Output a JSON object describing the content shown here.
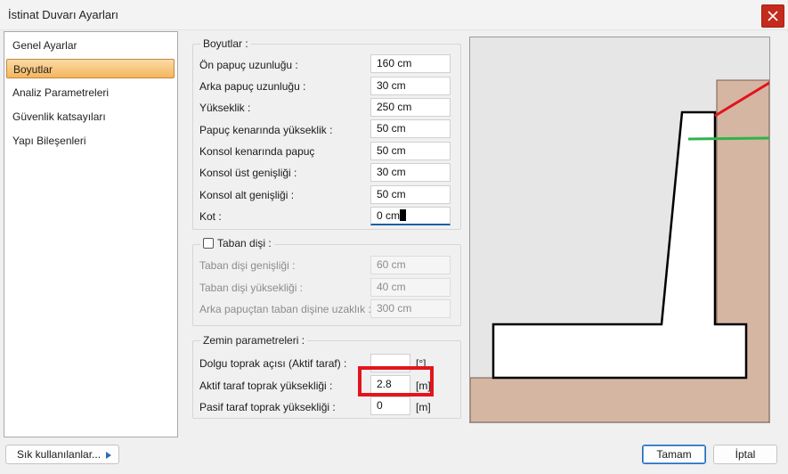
{
  "window": {
    "title": "İstinat Duvarı Ayarları"
  },
  "sidebar": {
    "items": [
      {
        "label": "Genel Ayarlar"
      },
      {
        "label": "Boyutlar"
      },
      {
        "label": "Analiz Parametreleri"
      },
      {
        "label": "Güvenlik katsayıları"
      },
      {
        "label": "Yapı Bileşenleri"
      }
    ],
    "active_index": 1
  },
  "dimensions": {
    "title": "Boyutlar :",
    "rows": [
      {
        "label": "Ön papuç uzunluğu :",
        "value": "160 cm"
      },
      {
        "label": "Arka papuç uzunluğu :",
        "value": "30 cm"
      },
      {
        "label": "Yükseklik :",
        "value": "250 cm"
      },
      {
        "label": "Papuç kenarında yükseklik :",
        "value": "50 cm"
      },
      {
        "label": "Konsol kenarında papuç",
        "value": "50 cm"
      },
      {
        "label": "Konsol üst genişliği :",
        "value": "30 cm"
      },
      {
        "label": "Konsol alt genişliği :",
        "value": "50 cm"
      },
      {
        "label": "Kot :",
        "value": "0 cm"
      }
    ]
  },
  "heel": {
    "title": "Taban dişi :",
    "checked": false,
    "rows": [
      {
        "label": "Taban dişi genişliği :",
        "value": "60 cm"
      },
      {
        "label": "Taban dişi yüksekliği :",
        "value": "40 cm"
      },
      {
        "label": "Arka papuçtan taban dişine uzaklık :",
        "value": "300 cm"
      }
    ]
  },
  "soil": {
    "title": "Zemin parametreleri :",
    "rows": [
      {
        "label": "Dolgu toprak açısı (Aktif taraf) :",
        "value": "",
        "unit": "[°]"
      },
      {
        "label": "Aktif taraf toprak yüksekliği :",
        "value": "2.8",
        "unit": "[m]"
      },
      {
        "label": "Pasif taraf toprak yüksekliği :",
        "value": "0",
        "unit": "[m]"
      }
    ]
  },
  "footer": {
    "frequent_label": "Sık kullanılanlar...",
    "ok_label": "Tamam",
    "cancel_label": "İptal"
  },
  "colors": {
    "soil_fill": "#d5b6a3",
    "active_line": "#e3141d",
    "passive_line": "#2fb34a",
    "highlight": "#e3141d",
    "close_button": "#c42b1c"
  },
  "icons": {
    "close": "close-icon",
    "arrow": "chevron-right-icon"
  }
}
